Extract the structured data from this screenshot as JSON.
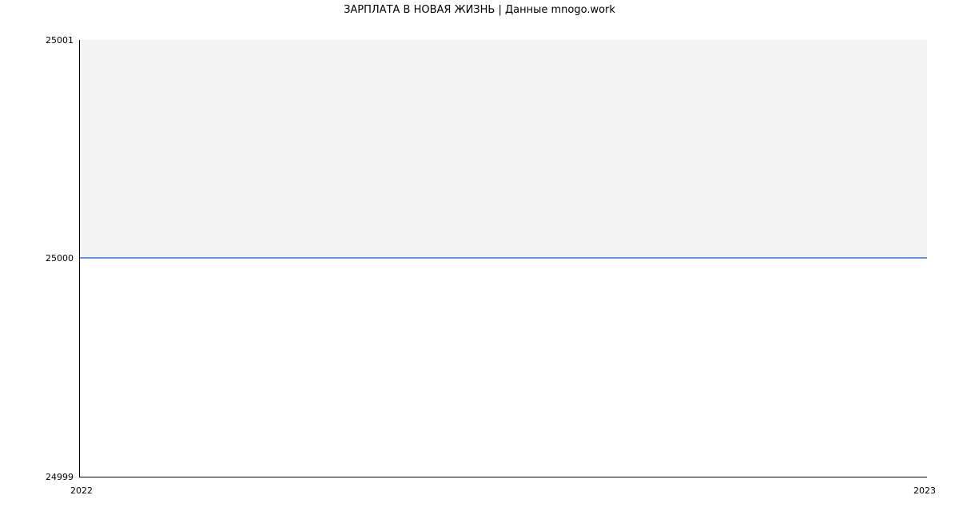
{
  "chart_data": {
    "type": "line",
    "title": "ЗАРПЛАТА В НОВАЯ ЖИЗНЬ | Данные mnogo.work",
    "x": [
      2022,
      2023
    ],
    "values": [
      25000,
      25000
    ],
    "xlabel": "",
    "ylabel": "",
    "ylim": [
      24999,
      25001
    ],
    "xlim": [
      2022,
      2023
    ],
    "y_ticks": [
      "24999",
      "25000",
      "25001"
    ],
    "x_ticks": [
      "2022",
      "2023"
    ],
    "line_color": "#6495ed"
  }
}
